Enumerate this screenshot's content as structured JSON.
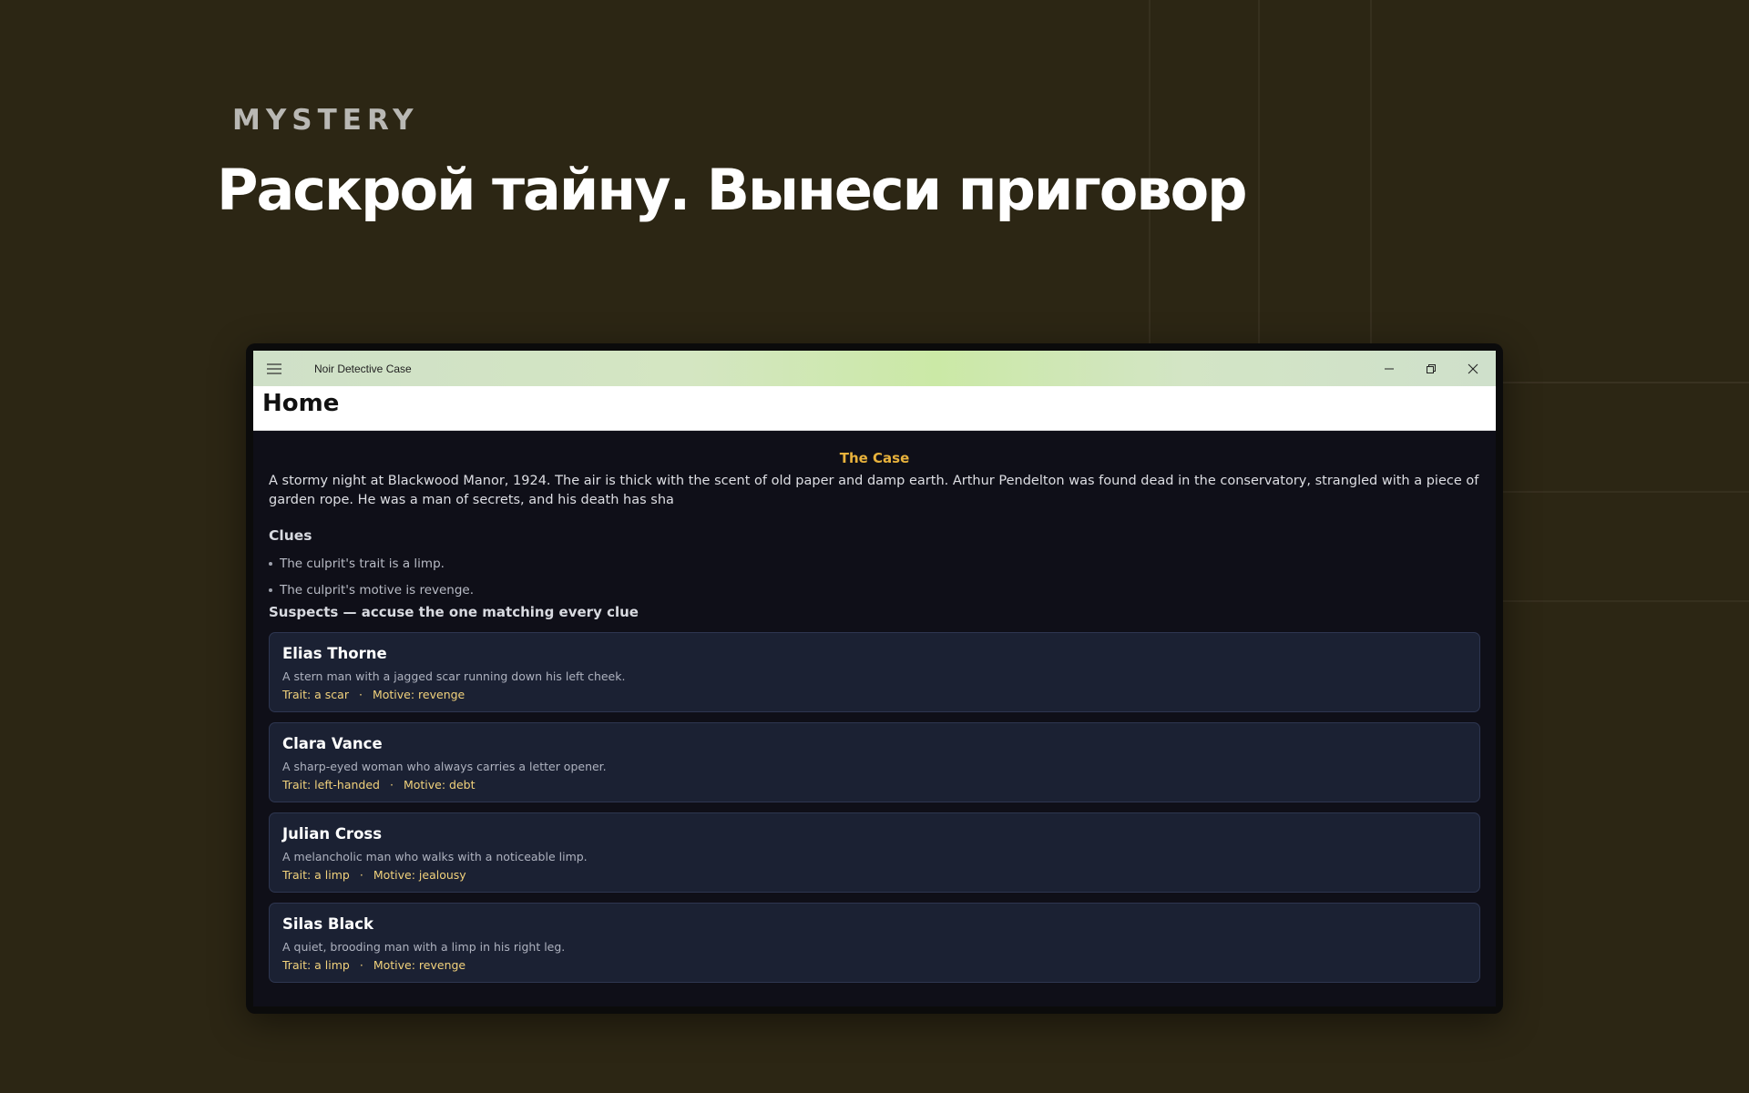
{
  "hero": {
    "eyebrow": "MYSTERY",
    "headline": "Раскрой тайну. Вынеси приговор"
  },
  "window": {
    "title": "Noir Detective Case",
    "page_title": "Home"
  },
  "case": {
    "title": "The Case",
    "text": "A stormy night at Blackwood Manor, 1924. The air is thick with the scent of old paper and damp earth. Arthur Pendelton was found dead in the conservatory, strangled with a piece of garden rope. He was a man of secrets, and his death has sha"
  },
  "clues": {
    "title": "Clues",
    "items": [
      "The culprit's trait is a limp.",
      "The culprit's motive is revenge."
    ]
  },
  "suspects": {
    "title": "Suspects — accuse the one matching every clue",
    "items": [
      {
        "name": "Elias Thorne",
        "desc": "A stern man with a jagged scar running down his left cheek.",
        "trait": "Trait: a scar",
        "motive": "Motive: revenge"
      },
      {
        "name": "Clara Vance",
        "desc": "A sharp-eyed woman who always carries a letter opener.",
        "trait": "Trait: left-handed",
        "motive": "Motive: debt"
      },
      {
        "name": "Julian Cross",
        "desc": "A melancholic man who walks with a noticeable limp.",
        "trait": "Trait: a limp",
        "motive": "Motive: jealousy"
      },
      {
        "name": "Silas Black",
        "desc": "A quiet, brooding man with a limp in his right leg.",
        "trait": "Trait: a limp",
        "motive": "Motive: revenge"
      }
    ]
  },
  "colors": {
    "background": "#2c2614",
    "accent": "#e8b23c",
    "card": "#1b2133",
    "meta": "#f2d27c"
  },
  "icons": {
    "menu": "hamburger-icon",
    "minimize": "minimize-icon",
    "maximize": "restore-icon",
    "close": "close-icon"
  }
}
